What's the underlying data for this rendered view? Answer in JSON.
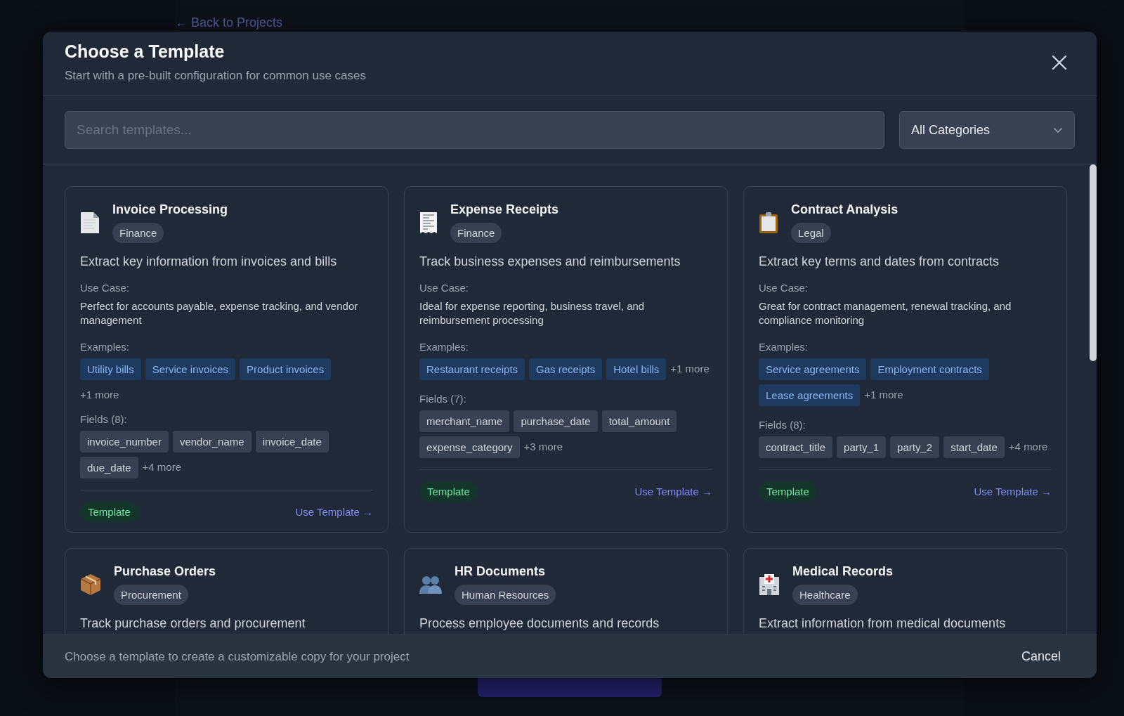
{
  "background": {
    "back_link": "← Back to Projects"
  },
  "modal": {
    "title": "Choose a Template",
    "subtitle": "Start with a pre-built configuration for common use cases",
    "search": {
      "placeholder": "Search templates..."
    },
    "category_select": {
      "value": "All Categories"
    },
    "templates": [
      {
        "title": "Invoice Processing",
        "category": "Finance",
        "description": "Extract key information from invoices and bills",
        "use_case_label": "Use Case:",
        "use_case": "Perfect for accounts payable, expense tracking, and vendor management",
        "examples_label": "Examples:",
        "examples": [
          "Utility bills",
          "Service invoices",
          "Product invoices"
        ],
        "examples_more": "+1 more",
        "fields_label": "Fields (8):",
        "fields": [
          "invoice_number",
          "vendor_name",
          "invoice_date",
          "due_date"
        ],
        "fields_more": "+4 more",
        "badge": "Template",
        "action": "Use Template →"
      },
      {
        "title": "Expense Receipts",
        "category": "Finance",
        "description": "Track business expenses and reimbursements",
        "use_case_label": "Use Case:",
        "use_case": "Ideal for expense reporting, business travel, and reimbursement processing",
        "examples_label": "Examples:",
        "examples": [
          "Restaurant receipts",
          "Gas receipts",
          "Hotel bills"
        ],
        "examples_more": "+1 more",
        "fields_label": "Fields (7):",
        "fields": [
          "merchant_name",
          "purchase_date",
          "total_amount",
          "expense_category"
        ],
        "fields_more": "+3 more",
        "badge": "Template",
        "action": "Use Template →"
      },
      {
        "title": "Contract Analysis",
        "category": "Legal",
        "description": "Extract key terms and dates from contracts",
        "use_case_label": "Use Case:",
        "use_case": "Great for contract management, renewal tracking, and compliance monitoring",
        "examples_label": "Examples:",
        "examples": [
          "Service agreements",
          "Employment contracts",
          "Lease agreements"
        ],
        "examples_more": "+1 more",
        "fields_label": "Fields (8):",
        "fields": [
          "contract_title",
          "party_1",
          "party_2",
          "start_date"
        ],
        "fields_more": "+4 more",
        "badge": "Template",
        "action": "Use Template →"
      },
      {
        "title": "Purchase Orders",
        "category": "Procurement",
        "description": "Track purchase orders and procurement"
      },
      {
        "title": "HR Documents",
        "category": "Human Resources",
        "description": "Process employee documents and records"
      },
      {
        "title": "Medical Records",
        "category": "Healthcare",
        "description": "Extract information from medical documents"
      }
    ],
    "footer": {
      "note": "Choose a template to create a customizable copy for your project",
      "cancel": "Cancel"
    }
  }
}
